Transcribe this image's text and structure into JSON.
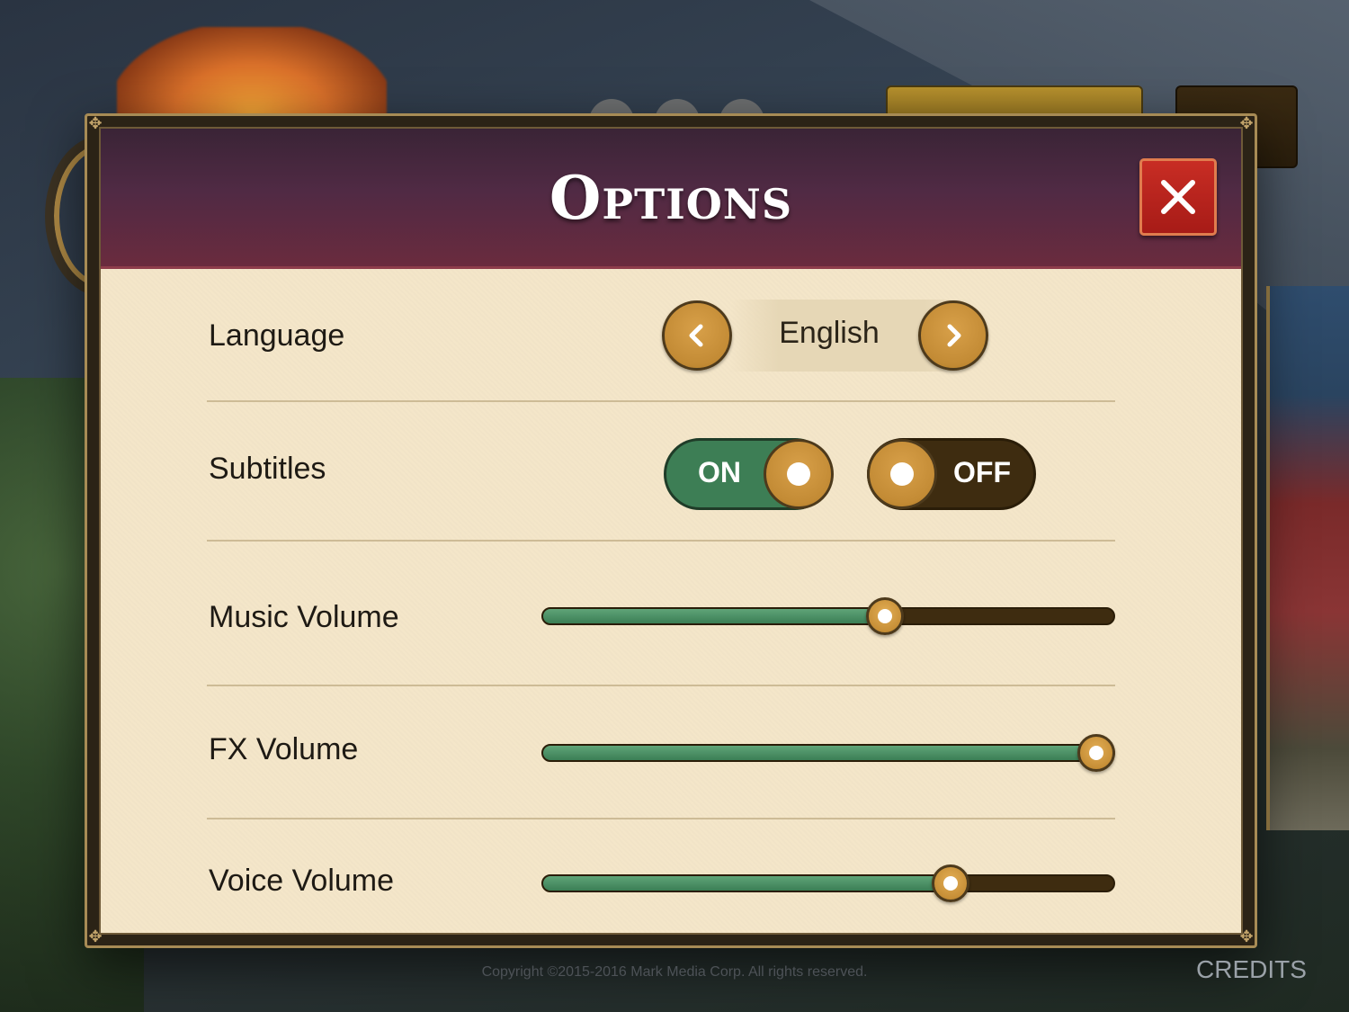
{
  "dialog": {
    "title": "Options",
    "close_icon": "close-icon"
  },
  "settings": {
    "language": {
      "label": "Language",
      "value": "English",
      "prev_icon": "chevron-left-icon",
      "next_icon": "chevron-right-icon"
    },
    "subtitles": {
      "label": "Subtitles",
      "on_label": "ON",
      "off_label": "OFF",
      "selected": "ON"
    },
    "music_volume": {
      "label": "Music Volume",
      "level": 0.6
    },
    "fx_volume": {
      "label": "FX Volume",
      "level": 0.97
    },
    "voice_volume": {
      "label": "Voice Volume",
      "level": 0.715
    }
  },
  "footer": {
    "copyright": "Copyright ©2015-2016 Mark Media Corp. All rights reserved.",
    "credits_label": "CREDITS"
  },
  "colors": {
    "header": "#502a44",
    "panel": "#f4e6c9",
    "accent_gold": "#c38b35",
    "on_green": "#3d7e55",
    "off_brown": "#3e2c10",
    "close_red": "#b8231c"
  }
}
